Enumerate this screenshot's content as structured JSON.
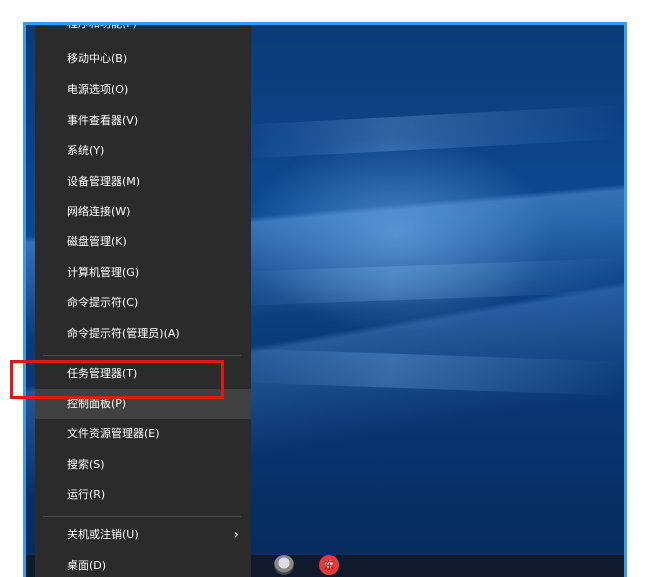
{
  "menu": {
    "items": [
      {
        "label": "程序和功能(F)"
      },
      {
        "label": "移动中心(B)"
      },
      {
        "label": "电源选项(O)"
      },
      {
        "label": "事件查看器(V)"
      },
      {
        "label": "系统(Y)"
      },
      {
        "label": "设备管理器(M)"
      },
      {
        "label": "网络连接(W)"
      },
      {
        "label": "磁盘管理(K)"
      },
      {
        "label": "计算机管理(G)"
      },
      {
        "label": "命令提示符(C)"
      },
      {
        "label": "命令提示符(管理员)(A)"
      },
      {
        "label": "任务管理器(T)"
      },
      {
        "label": "控制面板(P)"
      },
      {
        "label": "文件资源管理器(E)"
      },
      {
        "label": "搜索(S)"
      },
      {
        "label": "运行(R)"
      },
      {
        "label": "关机或注销(U)"
      },
      {
        "label": "桌面(D)"
      }
    ],
    "submenu_chevron": "›"
  },
  "taskbar": {
    "icons": [
      "robot-app-icon",
      "red-app-icon"
    ],
    "red_icon_glyph": "东"
  },
  "colors": {
    "menu_bg": "#2b2b2b",
    "active_item_bg": "#404040",
    "highlight_border": "#e3141c",
    "frame_border": "#3a9be8"
  }
}
